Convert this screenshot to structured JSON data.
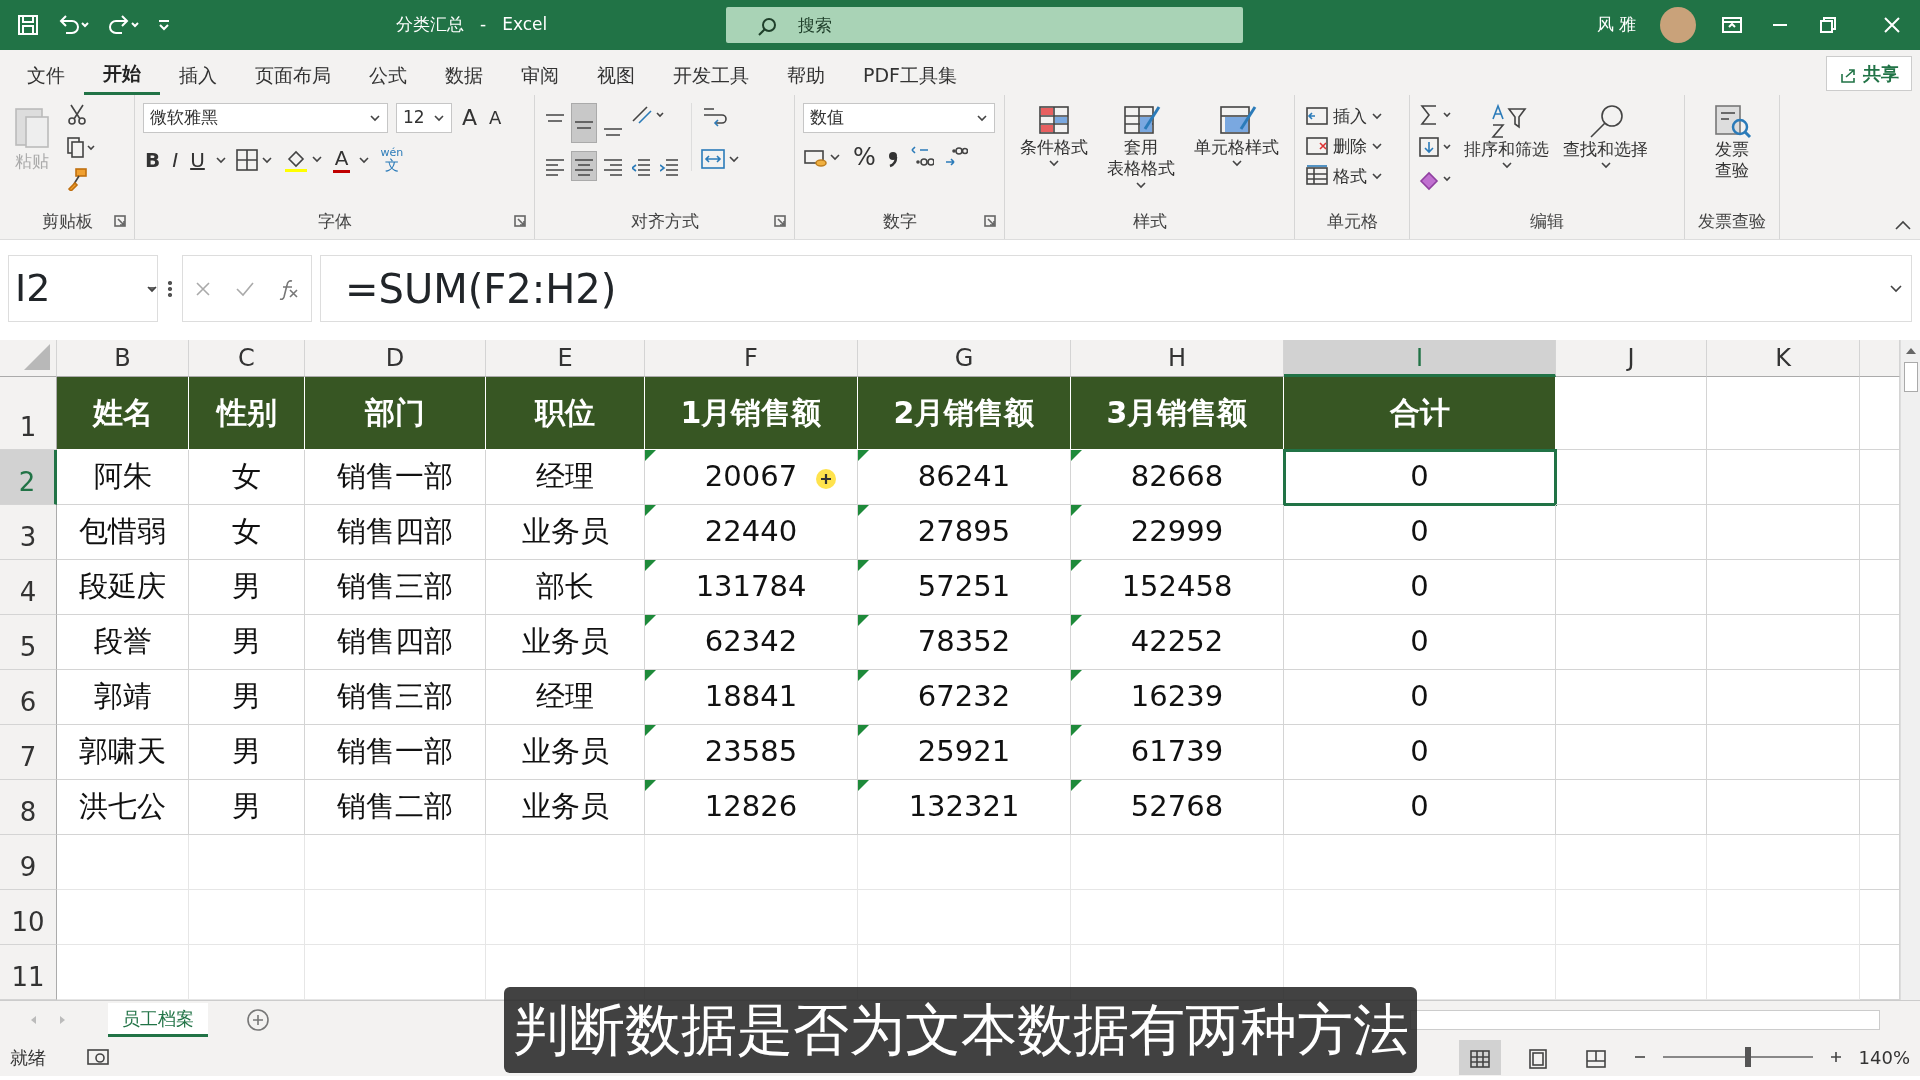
{
  "title_bar": {
    "file_name": "分类汇总",
    "separator": "-",
    "app": "Excel",
    "search_placeholder": "搜索",
    "user": "风 雅"
  },
  "tabs": [
    {
      "label": "文件",
      "selected": false
    },
    {
      "label": "开始",
      "selected": true
    },
    {
      "label": "插入",
      "selected": false
    },
    {
      "label": "页面布局",
      "selected": false
    },
    {
      "label": "公式",
      "selected": false
    },
    {
      "label": "数据",
      "selected": false
    },
    {
      "label": "审阅",
      "selected": false
    },
    {
      "label": "视图",
      "selected": false
    },
    {
      "label": "开发工具",
      "selected": false
    },
    {
      "label": "帮助",
      "selected": false
    },
    {
      "label": "PDF工具集",
      "selected": false
    }
  ],
  "share_button": "共享",
  "ribbon": {
    "clipboard": {
      "label": "剪贴板",
      "paste": "粘贴",
      "paste_disabled": true
    },
    "font": {
      "label": "字体",
      "font": "微软雅黑",
      "size": "12",
      "grow": "A",
      "shrink": "A",
      "bold": "B",
      "italic": "I",
      "underline": "U",
      "font_color": "A",
      "phonetic": [
        "wén",
        "文"
      ]
    },
    "alignment": {
      "label": "对齐方式",
      "vertical_selected": [
        false,
        true,
        false
      ],
      "horizontal_selected": [
        false,
        true,
        false,
        false,
        false
      ]
    },
    "number": {
      "label": "数字",
      "format": "数值",
      "percent": "%"
    },
    "styles": {
      "label": "样式",
      "buttons": [
        [
          "条件格式"
        ],
        [
          "套用",
          "表格格式"
        ],
        [
          "单元格样式"
        ]
      ]
    },
    "cells": {
      "label": "单元格",
      "buttons": [
        "插入",
        "删除",
        "格式"
      ]
    },
    "editing": {
      "label": "编辑",
      "buttons": [
        "排序和筛选",
        "查找和选择"
      ]
    },
    "invoice": {
      "label": "发票查验",
      "button": [
        "发票",
        "查验"
      ]
    }
  },
  "formula_bar": {
    "name_box": "I2",
    "formula": "=SUM(F2:H2)"
  },
  "columns": [
    {
      "letter": "B",
      "selected": false
    },
    {
      "letter": "C",
      "selected": false
    },
    {
      "letter": "D",
      "selected": false
    },
    {
      "letter": "E",
      "selected": false
    },
    {
      "letter": "F",
      "selected": false
    },
    {
      "letter": "G",
      "selected": false
    },
    {
      "letter": "H",
      "selected": false
    },
    {
      "letter": "I",
      "selected": true
    },
    {
      "letter": "J",
      "selected": false
    },
    {
      "letter": "K",
      "selected": false
    }
  ],
  "header_row": {
    "number": "1",
    "selected": false,
    "cells": [
      "姓名",
      "性别",
      "部门",
      "职位",
      "1月销售额",
      "2月销售额",
      "3月销售额",
      "合计"
    ]
  },
  "rows": [
    {
      "number": "2",
      "selected": true,
      "cells": [
        "阿朱",
        "女",
        "销售一部",
        "经理",
        "20067",
        "86241",
        "82668",
        "0"
      ],
      "flags": [
        false,
        false,
        false,
        false,
        true,
        true,
        true,
        false
      ]
    },
    {
      "number": "3",
      "selected": false,
      "cells": [
        "包惜弱",
        "女",
        "销售四部",
        "业务员",
        "22440",
        "27895",
        "22999",
        "0"
      ],
      "flags": [
        false,
        false,
        false,
        false,
        true,
        true,
        true,
        false
      ]
    },
    {
      "number": "4",
      "selected": false,
      "cells": [
        "段延庆",
        "男",
        "销售三部",
        "部长",
        "131784",
        "57251",
        "152458",
        "0"
      ],
      "flags": [
        false,
        false,
        false,
        false,
        true,
        true,
        true,
        false
      ]
    },
    {
      "number": "5",
      "selected": false,
      "cells": [
        "段誉",
        "男",
        "销售四部",
        "业务员",
        "62342",
        "78352",
        "42252",
        "0"
      ],
      "flags": [
        false,
        false,
        false,
        false,
        true,
        true,
        true,
        false
      ]
    },
    {
      "number": "6",
      "selected": false,
      "cells": [
        "郭靖",
        "男",
        "销售三部",
        "经理",
        "18841",
        "67232",
        "16239",
        "0"
      ],
      "flags": [
        false,
        false,
        false,
        false,
        true,
        true,
        true,
        false
      ]
    },
    {
      "number": "7",
      "selected": false,
      "cells": [
        "郭啸天",
        "男",
        "销售一部",
        "业务员",
        "23585",
        "25921",
        "61739",
        "0"
      ],
      "flags": [
        false,
        false,
        false,
        false,
        true,
        true,
        true,
        false
      ]
    },
    {
      "number": "8",
      "selected": false,
      "cells": [
        "洪七公",
        "男",
        "销售二部",
        "业务员",
        "12826",
        "132321",
        "52768",
        "0"
      ],
      "flags": [
        false,
        false,
        false,
        false,
        true,
        true,
        true,
        false
      ]
    }
  ],
  "empty_rows": [
    "9",
    "10",
    "11"
  ],
  "sheet_tabs": [
    {
      "label": "员工档案",
      "selected": true
    }
  ],
  "status_bar": {
    "ready": "就绪",
    "views_selected": [
      true,
      false,
      false
    ],
    "zoom": {
      "level": 0.57
    },
    "zoom_text": "140%"
  },
  "subtitle": "判断数据是否为文本数据有两种方法"
}
